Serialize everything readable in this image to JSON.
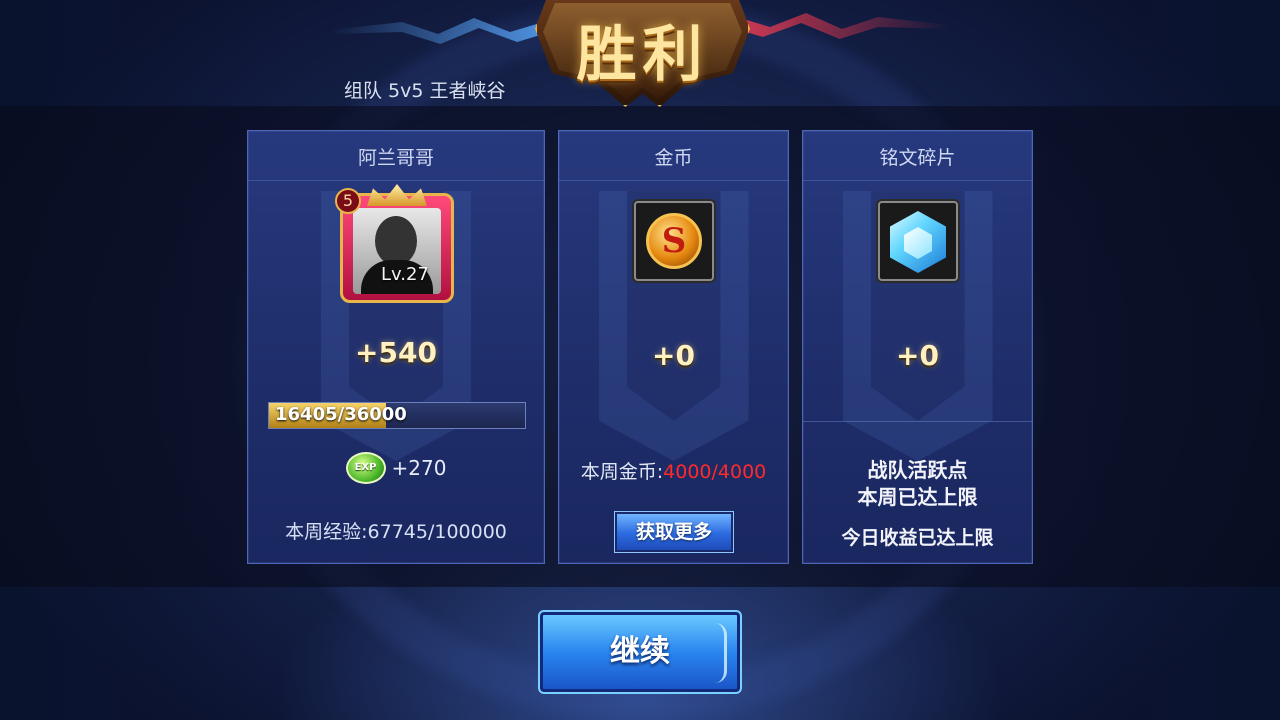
{
  "banner": {
    "title": "胜利",
    "mode": "组队 5v5 王者峡谷"
  },
  "hero_panel": {
    "name": "阿兰哥哥",
    "rank_badge": "5",
    "level": "Lv.27",
    "reward": "+540",
    "exp_bar": {
      "text": "16405/36000",
      "current": 16405,
      "max": 36000
    },
    "exp_icon_label": "EXP",
    "exp_bonus": "+270",
    "weekly_exp": "本周经验:67745/100000"
  },
  "coin_panel": {
    "title": "金币",
    "icon": "gold-coin-icon",
    "reward": "+0",
    "weekly_label": "本周金币:",
    "weekly_value": "4000/4000",
    "more_button": "获取更多"
  },
  "rune_panel": {
    "title": "铭文碎片",
    "icon": "rune-fragment-icon",
    "reward": "+0",
    "limit_line1": "战队活跃点",
    "limit_line2": "本周已达上限",
    "today_limit": "今日收益已达上限"
  },
  "continue_button": "继续",
  "colors": {
    "panel": "#223372",
    "accent_gold": "#fff1c2",
    "limit_red": "#ff2a2a",
    "button_blue": "#2a86f0"
  }
}
